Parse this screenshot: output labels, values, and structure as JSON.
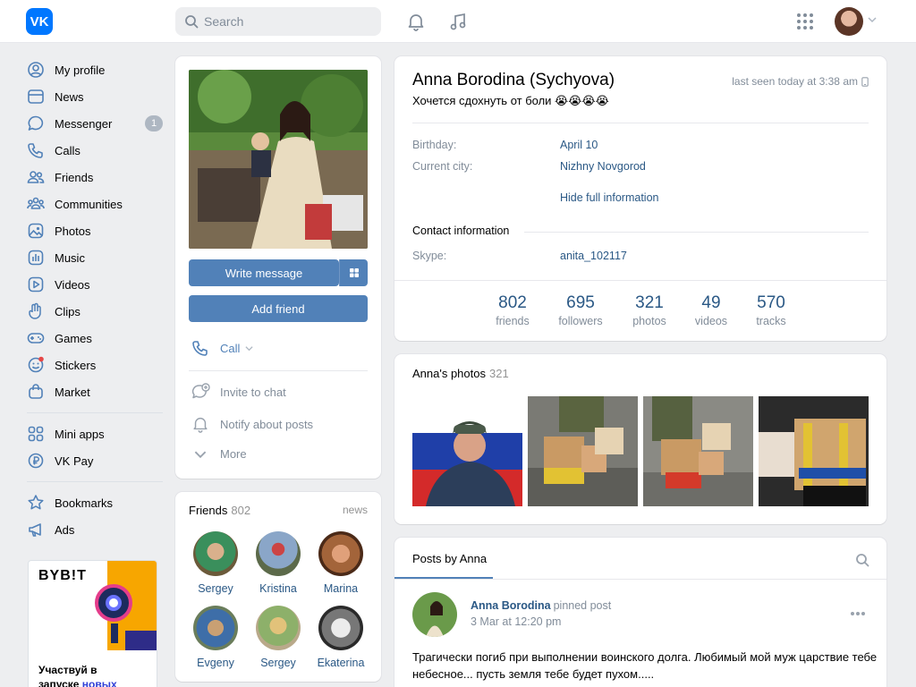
{
  "header": {
    "logo_text": "VK",
    "search_placeholder": "Search"
  },
  "sidebar": {
    "items": [
      {
        "label": "My profile",
        "icon": "profile-icon"
      },
      {
        "label": "News",
        "icon": "news-icon"
      },
      {
        "label": "Messenger",
        "icon": "messenger-icon",
        "badge": "1"
      },
      {
        "label": "Calls",
        "icon": "phone-icon"
      },
      {
        "label": "Friends",
        "icon": "friends-icon"
      },
      {
        "label": "Communities",
        "icon": "communities-icon"
      },
      {
        "label": "Photos",
        "icon": "photos-icon"
      },
      {
        "label": "Music",
        "icon": "music-icon"
      },
      {
        "label": "Videos",
        "icon": "videos-icon"
      },
      {
        "label": "Clips",
        "icon": "clips-icon"
      },
      {
        "label": "Games",
        "icon": "games-icon"
      },
      {
        "label": "Stickers",
        "icon": "stickers-icon"
      },
      {
        "label": "Market",
        "icon": "market-icon"
      }
    ],
    "items2": [
      {
        "label": "Mini apps",
        "icon": "mini-apps-icon"
      },
      {
        "label": "VK Pay",
        "icon": "vkpay-icon"
      }
    ],
    "items3": [
      {
        "label": "Bookmarks",
        "icon": "bookmarks-icon"
      },
      {
        "label": "Ads",
        "icon": "ads-icon"
      }
    ],
    "ad": {
      "brand": "BYB!T",
      "text_line1": "Участвуй в",
      "text_line2a": "запуске ",
      "text_line2b": "новых"
    }
  },
  "profile_actions": {
    "write_message": "Write message",
    "add_friend": "Add friend",
    "call": "Call",
    "invite_to_chat": "Invite to chat",
    "notify_posts": "Notify about posts",
    "more": "More"
  },
  "friends_block": {
    "title": "Friends",
    "count": "802",
    "news": "news",
    "friends": [
      {
        "name": "Sergey"
      },
      {
        "name": "Kristina"
      },
      {
        "name": "Marina"
      },
      {
        "name": "Evgeny"
      },
      {
        "name": "Sergey"
      },
      {
        "name": "Ekaterina"
      }
    ]
  },
  "profile": {
    "name": "Anna Borodina (Sychyova)",
    "status": "Хочется сдохнуть от боли 😭😭😭😭",
    "last_seen": "last seen today at 3:38 am",
    "birthday_label": "Birthday:",
    "birthday_value": "April 10",
    "city_label": "Current city:",
    "city_value": "Nizhny Novgorod",
    "hide_info": "Hide full information",
    "contact_title": "Contact information",
    "skype_label": "Skype:",
    "skype_value": "anita_102117"
  },
  "counters": [
    {
      "num": "802",
      "label": "friends"
    },
    {
      "num": "695",
      "label": "followers"
    },
    {
      "num": "321",
      "label": "photos"
    },
    {
      "num": "49",
      "label": "videos"
    },
    {
      "num": "570",
      "label": "tracks"
    }
  ],
  "photos_block": {
    "title": "Anna's photos",
    "count": "321"
  },
  "posts": {
    "tab": "Posts by Anna",
    "author": "Anna Borodina",
    "pinned": "pinned post",
    "date": "3 Mar at 12:20 pm",
    "text": "Трагически погиб при выполнении воинского долга. Любимый мой муж царствие тебе небесное... пусть земля тебе будет пухом....."
  },
  "colors": {
    "accent": "#5181b8",
    "link": "#2a5885",
    "brand": "#0077ff",
    "background": "#edeef0"
  }
}
